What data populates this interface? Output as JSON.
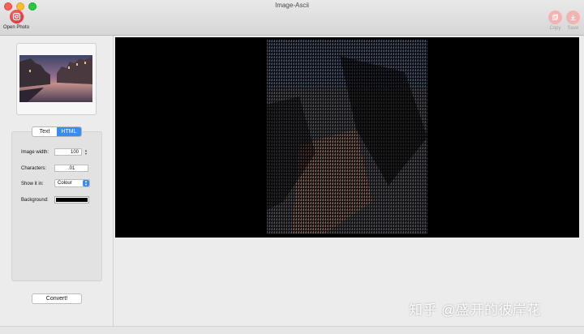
{
  "window": {
    "title": "Image-Ascii",
    "background_color": "#ececec"
  },
  "toolbar": {
    "open_label": "Open Photo",
    "copy_label": "Copy",
    "save_label": "Save"
  },
  "mode_tabs": [
    {
      "label": "Text",
      "active": false
    },
    {
      "label": "HTML",
      "active": true
    }
  ],
  "options": {
    "image_width_label": "Image width:",
    "image_width_value": "100",
    "characters_label": "Characters:",
    "characters_value": ".01",
    "show_in_label": "Show it in:",
    "show_in_value": "Colour",
    "background_label": "Background:",
    "background_color": "#000000"
  },
  "convert_label": "Convert!",
  "preview": {
    "background_color": "#000000"
  },
  "icons": {
    "open": "camera-icon",
    "copy": "copy-icon",
    "save": "save-icon"
  },
  "watermark": "知乎 @盛开的彼岸花",
  "accent_color": "#3b8cf2"
}
